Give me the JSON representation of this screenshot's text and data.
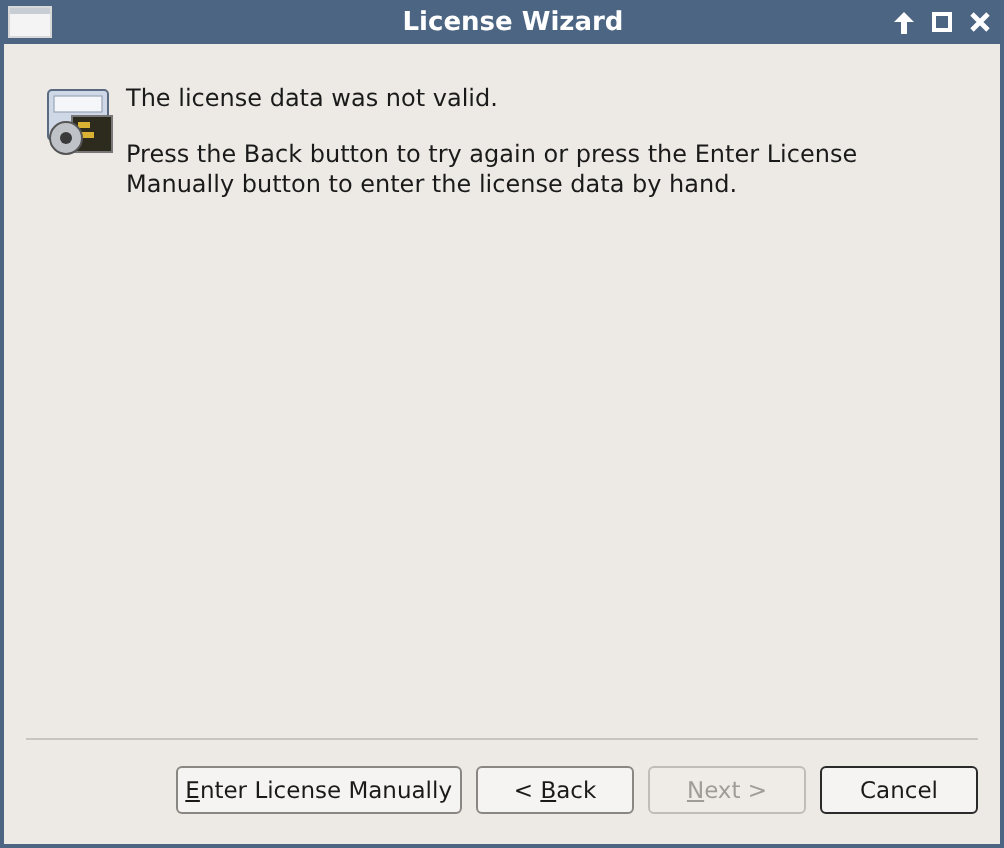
{
  "window": {
    "title": "License Wizard"
  },
  "message": {
    "heading": "The license data was not valid.",
    "body": "Press the Back button to try again or press the Enter License Manually button to enter the license data by hand."
  },
  "buttons": [
    {
      "mnemonic": "E",
      "label_rest": "nter License Manually",
      "disabled": false,
      "default": false
    },
    {
      "label_start": "< ",
      "mnemonic": "B",
      "label_rest": "ack",
      "disabled": false,
      "default": false
    },
    {
      "mnemonic": "N",
      "label_rest": "ext >",
      "disabled": true,
      "default": false
    },
    {
      "label": "Cancel",
      "disabled": false,
      "default": true
    }
  ]
}
